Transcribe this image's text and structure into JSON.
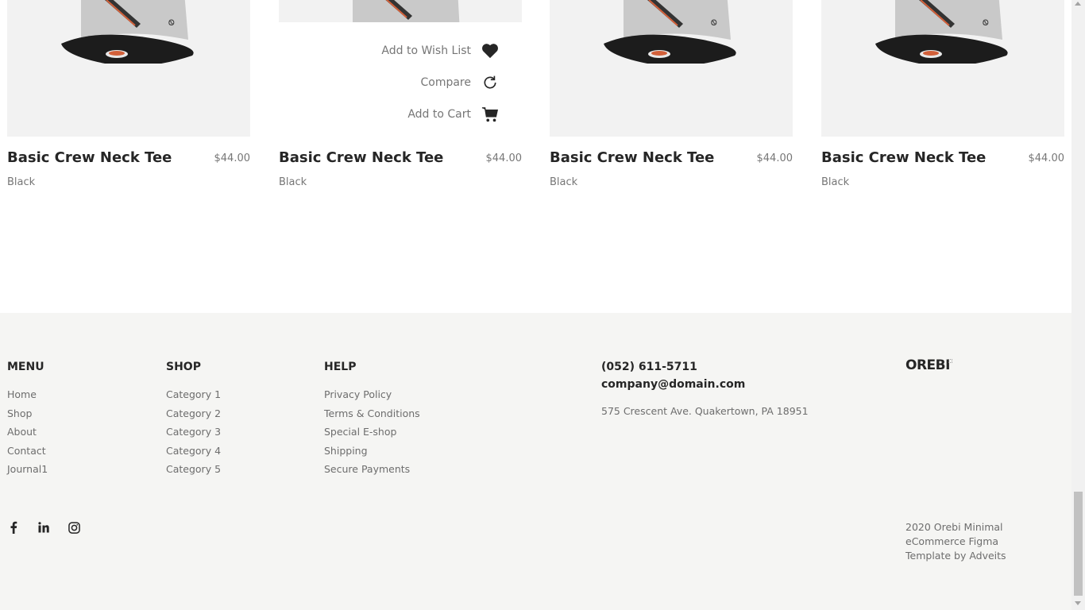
{
  "products": [
    {
      "title": "Basic Crew Neck Tee",
      "price": "$44.00",
      "color": "Black"
    },
    {
      "title": "Basic Crew Neck Tee",
      "price": "$44.00",
      "color": "Black"
    },
    {
      "title": "Basic Crew Neck Tee",
      "price": "$44.00",
      "color": "Black"
    },
    {
      "title": "Basic Crew Neck Tee",
      "price": "$44.00",
      "color": "Black"
    }
  ],
  "hover_actions": {
    "wishlist_label": "Add to Wish List",
    "compare_label": "Compare",
    "cart_label": "Add to Cart"
  },
  "footer": {
    "menu": {
      "title": "MENU",
      "items": [
        "Home",
        "Shop",
        "About",
        "Contact",
        "Journal1"
      ]
    },
    "shop": {
      "title": "SHOP",
      "items": [
        "Category 1",
        "Category 2",
        "Category 3",
        "Category 4",
        "Category 5"
      ]
    },
    "help": {
      "title": "HELP",
      "items": [
        "Privacy Policy",
        "Terms & Conditions",
        "Special E-shop",
        "Shipping",
        "Secure Payments"
      ]
    },
    "contact": {
      "phone": "(052) 611-5711",
      "email": "company@domain.com",
      "address": "575 Crescent Ave. Quakertown, PA 18951"
    },
    "logo": "OREBI",
    "social_icons": [
      "facebook-icon",
      "linkedin-icon",
      "instagram-icon"
    ],
    "copyright": "2020 Orebi Minimal eCommerce Figma Template by Adveits"
  },
  "colors": {
    "footer_bg": "#f5f5f3",
    "image_bg": "#f2f2f2",
    "text_dark": "#262626",
    "text_muted": "#767676"
  }
}
